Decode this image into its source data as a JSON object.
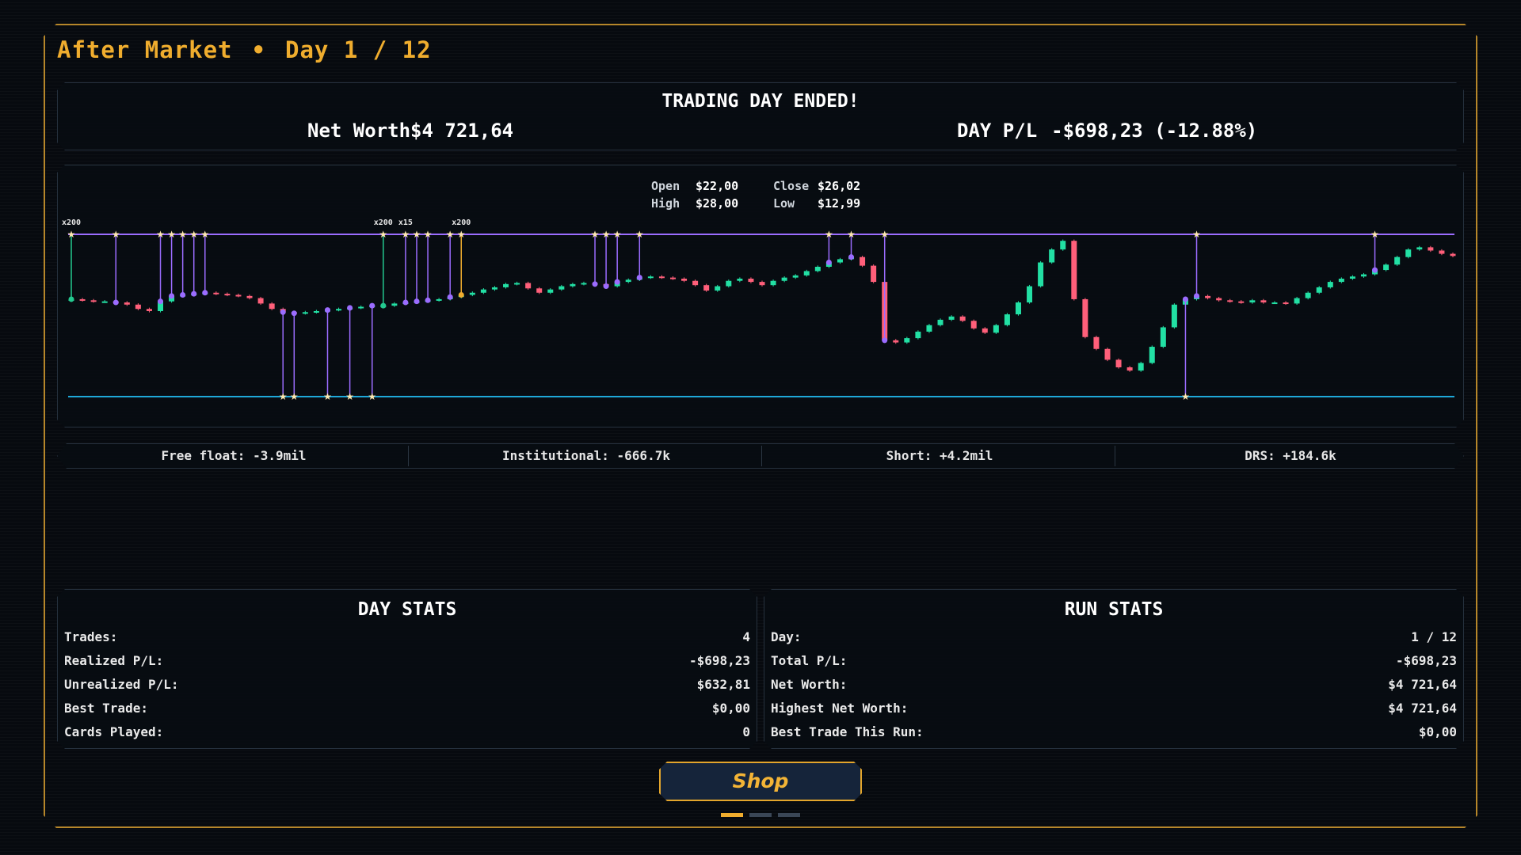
{
  "header": {
    "phase": "After Market",
    "separator": "•",
    "day": "Day 1 / 12"
  },
  "summary": {
    "title": "TRADING DAY ENDED!",
    "net_worth_label": "Net Worth",
    "net_worth_value": "$4 721,64",
    "day_pl_label": "DAY P/L",
    "day_pl_value": "-$698,23 (-12.88%)"
  },
  "ohlc": {
    "open_label": "Open",
    "open": "$22,00",
    "close_label": "Close",
    "close": "$26,02",
    "high_label": "High",
    "high": "$28,00",
    "low_label": "Low",
    "low": "$12,99"
  },
  "chart_data": {
    "type": "candlestick",
    "open": 22.0,
    "high": 28.0,
    "low": 12.99,
    "close": 26.02,
    "y_high_line": 28.0,
    "y_low_line": 12.99,
    "candles": [
      22.0,
      21.9,
      21.8,
      21.8,
      21.7,
      21.5,
      21.1,
      20.9,
      21.8,
      22.3,
      22.4,
      22.5,
      22.6,
      22.5,
      22.4,
      22.3,
      22.1,
      21.6,
      21.1,
      20.8,
      20.7,
      20.8,
      20.9,
      21.0,
      21.1,
      21.2,
      21.3,
      21.4,
      21.4,
      21.6,
      21.7,
      21.8,
      21.9,
      22.0,
      22.2,
      22.4,
      22.6,
      22.9,
      23.1,
      23.4,
      23.5,
      23.0,
      22.6,
      22.9,
      23.2,
      23.4,
      23.5,
      23.4,
      23.2,
      23.6,
      23.8,
      24.0,
      24.1,
      24.0,
      23.9,
      23.7,
      23.3,
      22.8,
      23.2,
      23.7,
      23.9,
      23.6,
      23.3,
      23.7,
      24.0,
      24.2,
      24.6,
      25.0,
      25.4,
      25.7,
      25.9,
      25.1,
      23.6,
      18.2,
      18.0,
      18.4,
      19.0,
      19.6,
      20.1,
      20.4,
      20.0,
      19.3,
      18.9,
      19.6,
      20.6,
      21.7,
      23.2,
      25.4,
      26.6,
      27.4,
      22.0,
      18.5,
      17.4,
      16.4,
      15.7,
      15.4,
      16.1,
      17.6,
      19.4,
      21.5,
      22.0,
      22.3,
      22.1,
      21.9,
      21.8,
      21.7,
      21.9,
      21.7,
      21.7,
      21.6,
      22.1,
      22.6,
      23.1,
      23.6,
      23.9,
      24.1,
      24.3,
      24.7,
      25.2,
      25.9,
      26.6,
      26.8,
      26.5,
      26.2,
      26.0
    ]
  },
  "markers": {
    "labels": [
      "x200",
      "x200",
      "x15",
      "x200"
    ]
  },
  "share_stats": [
    {
      "label": "Free float:",
      "value": "-3.9mil"
    },
    {
      "label": "Institutional:",
      "value": "-666.7k"
    },
    {
      "label": "Short:",
      "value": "+4.2mil"
    },
    {
      "label": "DRS:",
      "value": "+184.6k"
    }
  ],
  "day_stats": {
    "title": "DAY STATS",
    "rows": [
      {
        "label": "Trades:",
        "value": "4"
      },
      {
        "label": "Realized P/L:",
        "value": "-$698,23"
      },
      {
        "label": "Unrealized P/L:",
        "value": "$632,81"
      },
      {
        "label": "Best Trade:",
        "value": "$0,00"
      },
      {
        "label": "Cards Played:",
        "value": "0"
      }
    ]
  },
  "run_stats": {
    "title": "RUN STATS",
    "rows": [
      {
        "label": "Day:",
        "value": "1 / 12"
      },
      {
        "label": "Total P/L:",
        "value": "-$698,23"
      },
      {
        "label": "Net Worth:",
        "value": "$4 721,64"
      },
      {
        "label": "Highest Net Worth:",
        "value": "$4 721,64"
      },
      {
        "label": "Best Trade This Run:",
        "value": "$0,00"
      }
    ]
  },
  "shop_button": "Shop",
  "colors": {
    "accent": "#f0ad2e",
    "up": "#22e0a4",
    "down": "#ff5f7a",
    "high_line": "#9b6cff",
    "low_line": "#1ea8d8"
  }
}
